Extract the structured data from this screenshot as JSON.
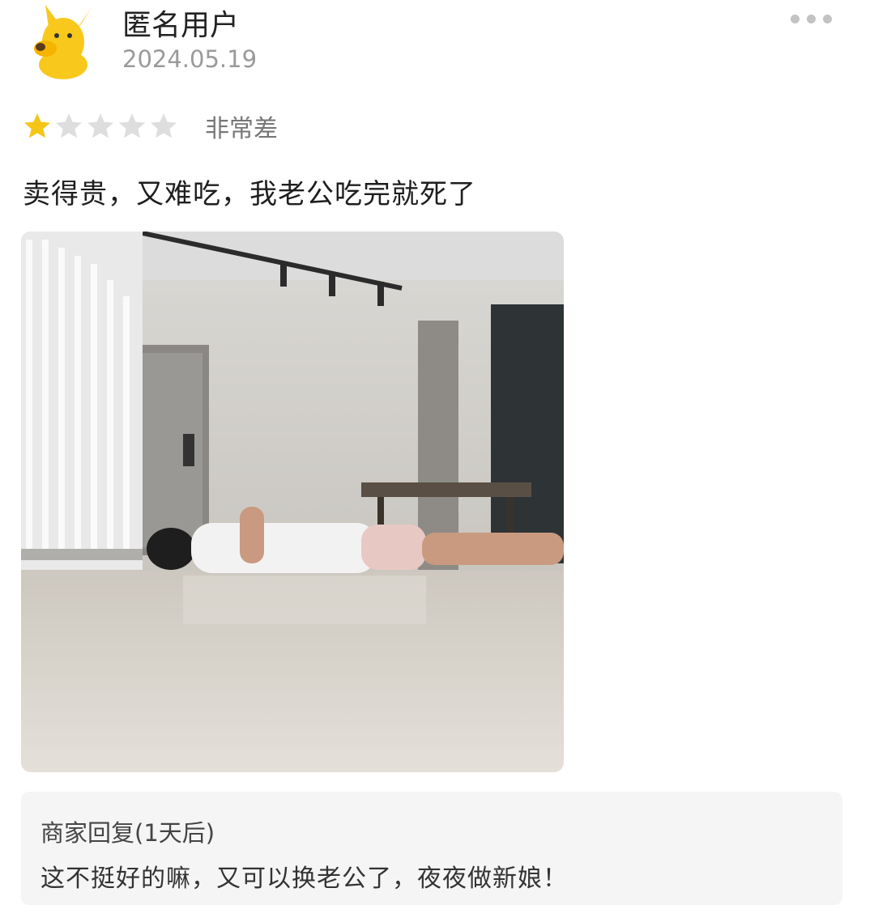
{
  "review": {
    "user_name": "匿名用户",
    "date": "2024.05.19",
    "rating": 1,
    "rating_max": 5,
    "rating_label": "非常差",
    "text": "卖得贵，又难吃，我老公吃完就死了"
  },
  "reply": {
    "header": "商家回复(1天后)",
    "text": "这不挺好的嘛，又可以换老公了，夜夜做新娘！"
  },
  "icons": {
    "avatar": "yellow-dog-avatar-icon",
    "more": "more-dots-icon",
    "star": "star-icon"
  },
  "colors": {
    "star_filled": "#f5c518",
    "star_empty": "#dedede",
    "avatar_yellow": "#f8c81c"
  }
}
